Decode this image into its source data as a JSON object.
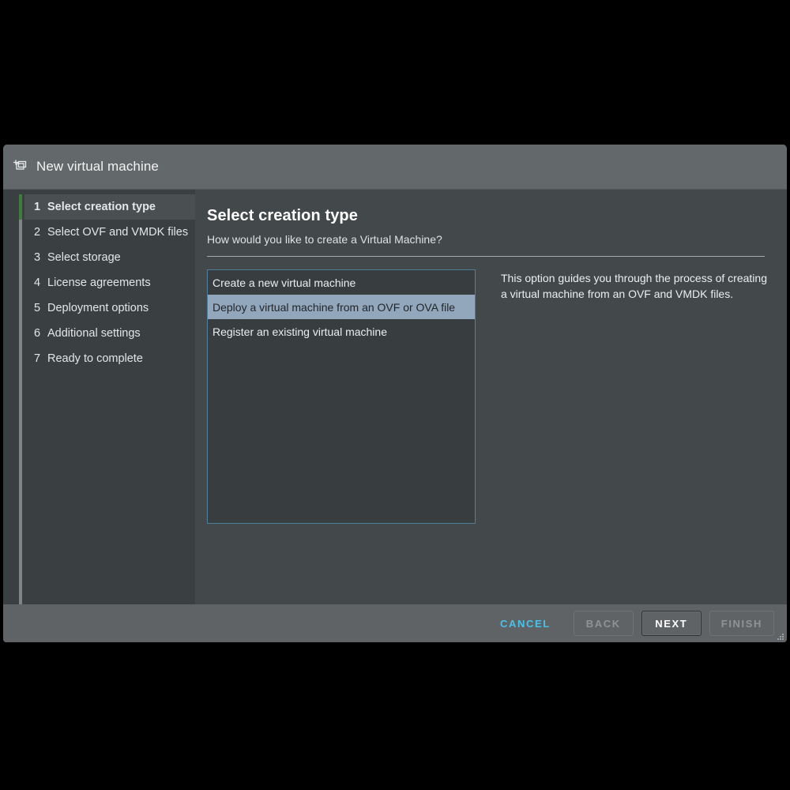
{
  "window": {
    "title": "New virtual machine",
    "icon": "new-vm-icon"
  },
  "sidebar": {
    "steps": [
      {
        "num": "1",
        "label": "Select creation type",
        "active": true
      },
      {
        "num": "2",
        "label": "Select OVF and VMDK files",
        "active": false
      },
      {
        "num": "3",
        "label": "Select storage",
        "active": false
      },
      {
        "num": "4",
        "label": "License agreements",
        "active": false
      },
      {
        "num": "5",
        "label": "Deployment options",
        "active": false
      },
      {
        "num": "6",
        "label": "Additional settings",
        "active": false
      },
      {
        "num": "7",
        "label": "Ready to complete",
        "active": false
      }
    ]
  },
  "main": {
    "title": "Select creation type",
    "subtitle": "How would you like to create a Virtual Machine?",
    "options": [
      {
        "label": "Create a new virtual machine",
        "selected": false
      },
      {
        "label": "Deploy a virtual machine from an OVF or OVA file",
        "selected": true
      },
      {
        "label": "Register an existing virtual machine",
        "selected": false
      }
    ],
    "description": "This option guides you through the process of creating a virtual machine from an OVF and VMDK files."
  },
  "footer": {
    "cancel_label": "CANCEL",
    "back_label": "BACK",
    "next_label": "NEXT",
    "finish_label": "FINISH"
  },
  "colors": {
    "accent_cyan": "#49c2e8",
    "step_active_green": "#3e7d3c",
    "selection_blue": "#93a7bc",
    "listbox_border": "#4e7f9c",
    "titlebar_bg": "#63686a",
    "sidebar_bg": "#3a3f41",
    "main_bg": "#43484a",
    "footer_bg": "#5f6366"
  }
}
